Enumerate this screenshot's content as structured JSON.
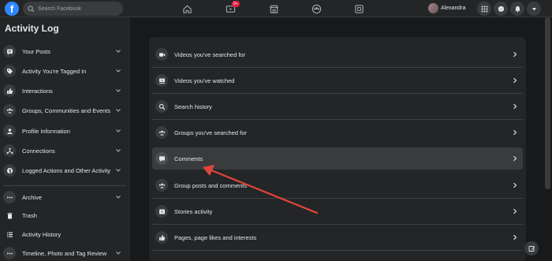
{
  "topbar": {
    "logo": "f",
    "search_placeholder": "Search Facebook",
    "watch_badge": "9+",
    "profile_name": "Alexandra",
    "nav_icons": [
      "home-icon",
      "watch-icon",
      "marketplace-icon",
      "groups-icon",
      "gaming-icon"
    ],
    "right_icons": [
      "menu-grid-icon",
      "messenger-icon",
      "notifications-icon",
      "account-dropdown-icon"
    ]
  },
  "sidebar": {
    "title": "Activity Log",
    "items": [
      {
        "label": "Your Posts",
        "icon": "posts-icon",
        "chevron": true
      },
      {
        "label": "Activity You're Tagged In",
        "icon": "tag-icon",
        "chevron": true
      },
      {
        "label": "Interactions",
        "icon": "like-icon",
        "chevron": true
      },
      {
        "label": "Groups, Communities and Events",
        "icon": "groups-icon",
        "chevron": true
      },
      {
        "label": "Profile Information",
        "icon": "profile-icon",
        "chevron": true
      },
      {
        "label": "Connections",
        "icon": "connections-icon",
        "chevron": true
      },
      {
        "label": "Logged Actions and Other Activity",
        "icon": "logged-actions-icon",
        "chevron": true
      },
      {
        "label": "Archive",
        "icon": "more-icon",
        "chevron": true
      },
      {
        "label": "Trash",
        "icon": "trash-icon",
        "chevron": false
      },
      {
        "label": "Activity History",
        "icon": "list-icon",
        "chevron": false
      },
      {
        "label": "Timeline, Photo and Tag Review",
        "icon": "more-icon",
        "chevron": true
      }
    ]
  },
  "main": {
    "rows": [
      {
        "label": "Videos you've searched for",
        "icon": "video-search-icon"
      },
      {
        "label": "Videos you've watched",
        "icon": "video-watched-icon"
      },
      {
        "label": "Search history",
        "icon": "search-icon"
      },
      {
        "label": "Groups you've searched for",
        "icon": "groups-icon"
      },
      {
        "label": "Comments",
        "icon": "comment-icon",
        "active": true
      },
      {
        "label": "Group posts and comments",
        "icon": "groups-icon"
      },
      {
        "label": "Stories activity",
        "icon": "stories-icon"
      },
      {
        "label": "Pages, page likes and interests",
        "icon": "like-icon"
      }
    ]
  },
  "colors": {
    "background": "#18191a",
    "surface": "#242526",
    "hover": "#3a3b3c",
    "accent": "#2d88ff",
    "annotation_arrow": "#e0463a"
  }
}
